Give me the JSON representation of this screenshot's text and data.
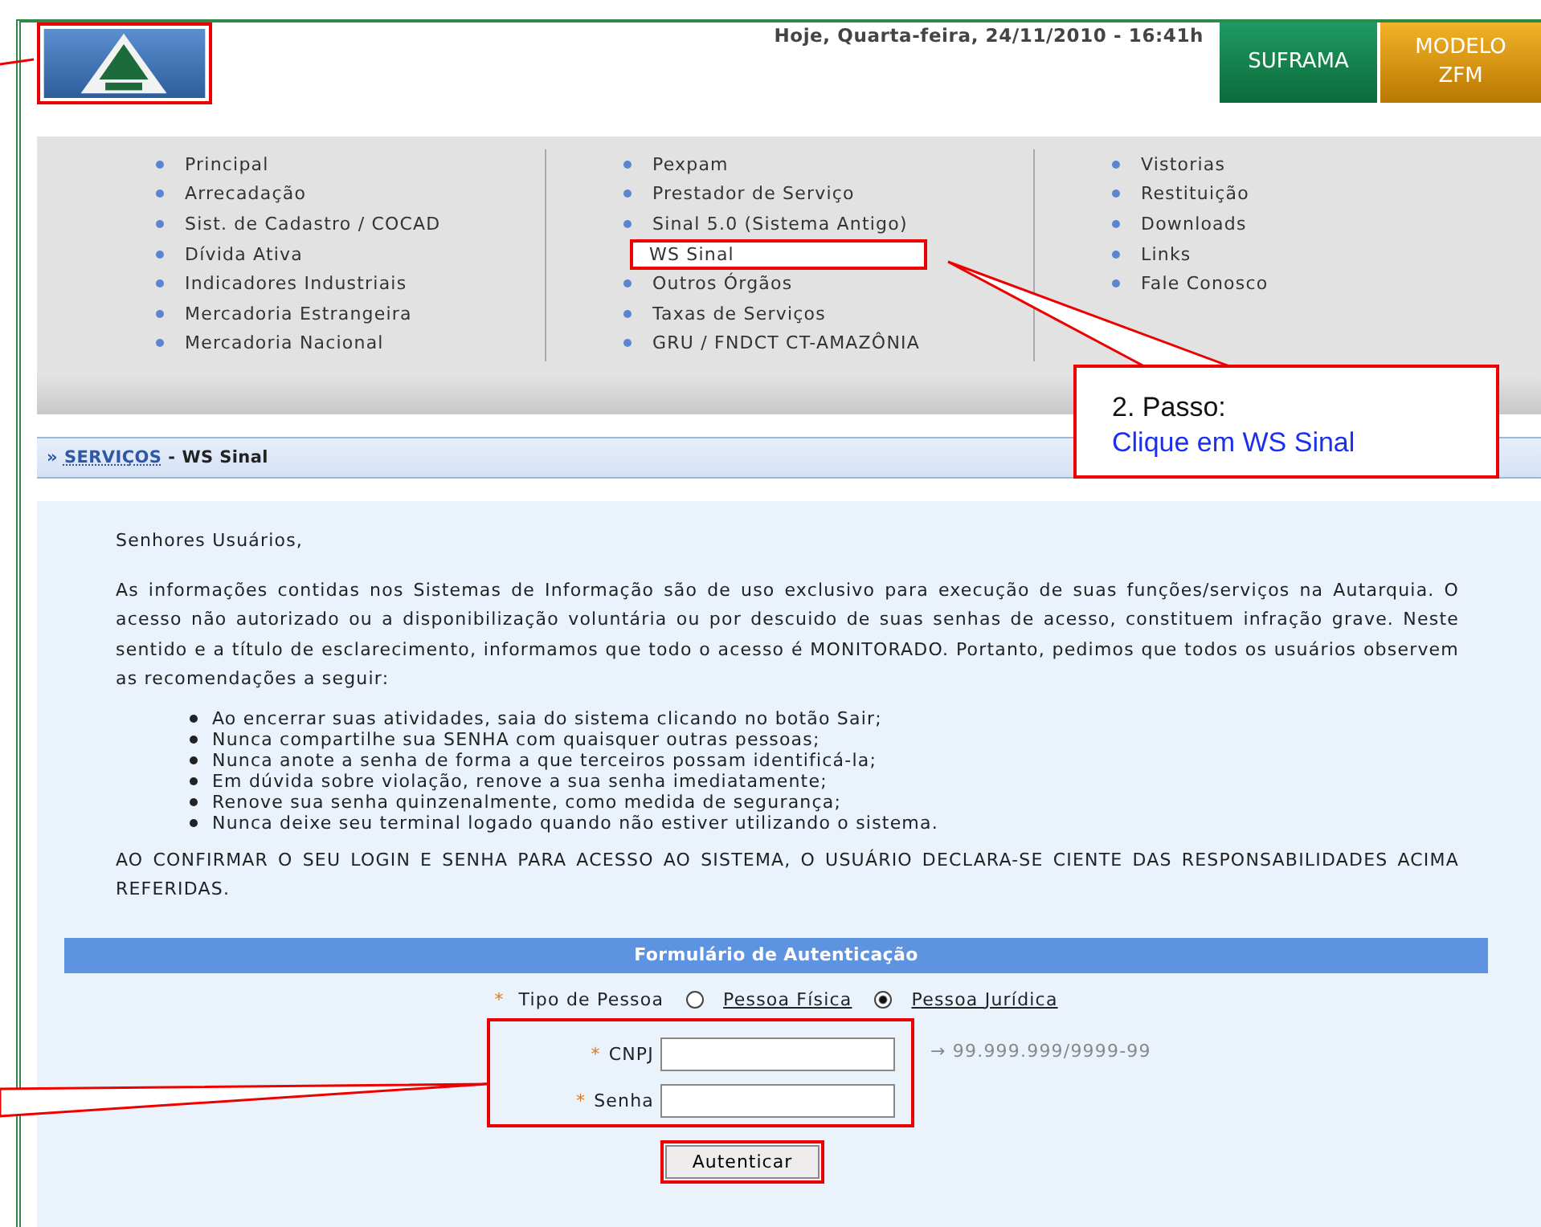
{
  "header": {
    "date": "Hoje, Quarta-feira, 24/11/2010 - 16:41h",
    "buttons": [
      {
        "label": "SUFRAMA",
        "kind": "green"
      },
      {
        "label": "MODELO ZFM",
        "kind": "orange"
      }
    ]
  },
  "menu": {
    "columns": [
      [
        {
          "label": "Principal",
          "selected": false
        },
        {
          "label": "Arrecadação",
          "selected": false
        },
        {
          "label": "Sist. de Cadastro / COCAD",
          "selected": false
        },
        {
          "label": "Dívida Ativa",
          "selected": false
        },
        {
          "label": "Indicadores Industriais",
          "selected": false
        },
        {
          "label": "Mercadoria Estrangeira",
          "selected": false
        },
        {
          "label": "Mercadoria Nacional",
          "selected": false
        }
      ],
      [
        {
          "label": "Pexpam",
          "selected": false
        },
        {
          "label": "Prestador de Serviço",
          "selected": false
        },
        {
          "label": "Sinal 5.0 (Sistema Antigo)",
          "selected": false
        },
        {
          "label": "WS Sinal",
          "selected": true
        },
        {
          "label": "Outros Órgãos",
          "selected": false
        },
        {
          "label": "Taxas de Serviços",
          "selected": false
        },
        {
          "label": "GRU / FNDCT CT-AMAZÔNIA",
          "selected": false
        }
      ],
      [
        {
          "label": "Vistorias",
          "selected": false
        },
        {
          "label": "Restituição",
          "selected": false
        },
        {
          "label": "Downloads",
          "selected": false
        },
        {
          "label": "Links",
          "selected": false
        },
        {
          "label": "Fale Conosco",
          "selected": false
        }
      ]
    ]
  },
  "breadcrumb": {
    "prefix": "»",
    "section": "SERVIÇOS",
    "separator": "-",
    "page": "WS Sinal"
  },
  "notice": {
    "greeting": "Senhores Usuários,",
    "paragraph": "As informações contidas nos Sistemas de Informação são de uso exclusivo para execução de suas funções/serviços na Autarquia. O acesso não autorizado ou a disponibilização voluntária ou por descuido de suas senhas de acesso, constituem infração grave. Neste sentido e a título de esclarecimento, informamos que todo o acesso é MONITORADO. Portanto, pedimos que todos os usuários observem as recomendações a seguir:",
    "items": [
      "Ao encerrar suas atividades, saia do sistema clicando no botão Sair;",
      "Nunca compartilhe sua SENHA com quaisquer outras pessoas;",
      "Nunca anote a senha de forma a que terceiros possam identificá-la;",
      "Em dúvida sobre violação, renove a sua senha imediatamente;",
      "Renove sua senha quinzenalmente, como medida de segurança;",
      "Nunca deixe seu terminal logado quando não estiver utilizando o sistema."
    ],
    "closing": "AO CONFIRMAR O SEU LOGIN E SENHA PARA ACESSO AO SISTEMA, O USUÁRIO DECLARA-SE CIENTE DAS RESPONSABILIDADES ACIMA REFERIDAS."
  },
  "form": {
    "title": "Formulário de Autenticação",
    "required_mark": "*",
    "person_type": {
      "label": "Tipo de Pessoa",
      "options": [
        {
          "label": "Pessoa Física",
          "selected": false
        },
        {
          "label": "Pessoa Jurídica",
          "selected": true
        }
      ]
    },
    "fields": [
      {
        "label": "CNPJ",
        "hint": "→ 99.999.999/9999-99"
      },
      {
        "label": "Senha"
      }
    ],
    "submit": "Autenticar"
  },
  "callout": {
    "step": "2. Passo:",
    "instruction": "Clique em WS Sinal"
  }
}
